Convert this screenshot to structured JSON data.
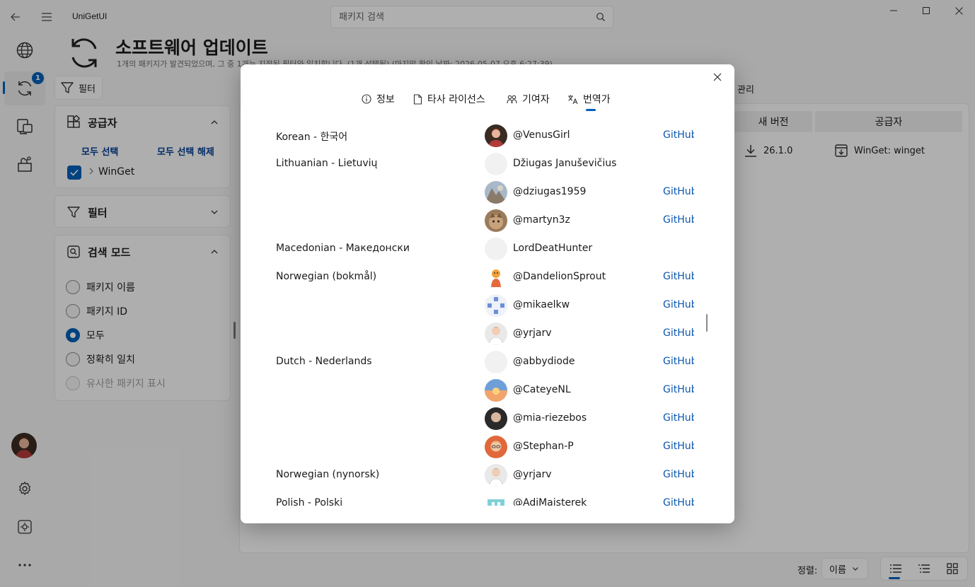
{
  "app": {
    "title": "UniGetUI"
  },
  "search": {
    "placeholder": "패키지 검색"
  },
  "nav": {
    "updates_badge": "1"
  },
  "page": {
    "title": "소프트웨어 업데이트",
    "subtitle": "1개의 패키지가 발견되었으며, 그 중 1개는 지정된 필터와 일치합니다. (1개 선택됨) (마지막 확인 날짜: 2026-05-07 오후 6:27:39)"
  },
  "toolbar": {
    "filter_label": "필터",
    "manage_label": "관리"
  },
  "sources_panel": {
    "title": "공급자",
    "select_all": "모두 선택",
    "deselect_all": "모두 선택 해제",
    "source_name": "WinGet"
  },
  "filters_panel": {
    "title": "필터"
  },
  "search_mode_panel": {
    "title": "검색 모드",
    "options": [
      "패키지 이름",
      "패키지 ID",
      "모두",
      "정확히 일치",
      "유사한 패키지 표시"
    ],
    "selected": "모두"
  },
  "table": {
    "headers": {
      "new_version": "새 버전",
      "source": "공급자"
    },
    "row": {
      "new_version": "26.1.0",
      "source": "WinGet: winget"
    }
  },
  "bottom_bar": {
    "sort_label": "정렬:",
    "sort_value": "이름"
  },
  "dialog": {
    "tabs": [
      "정보",
      "타사 라이선스",
      "기여자",
      "번역가"
    ],
    "active_tab": "번역가",
    "link_label": "GitHub",
    "rows": [
      {
        "language": "Korean - 한국어",
        "translator": "@VenusGirl",
        "link": true
      },
      {
        "language": "Lithuanian - Lietuvių",
        "translator": "Džiugas Januševičius",
        "link": false
      },
      {
        "language": "",
        "translator": "@dziugas1959",
        "link": true
      },
      {
        "language": "",
        "translator": "@martyn3z",
        "link": true
      },
      {
        "language": "Macedonian - Македонски",
        "translator": "LordDeatHunter",
        "link": false
      },
      {
        "language": "Norwegian (bokmål)",
        "translator": "@DandelionSprout",
        "link": true
      },
      {
        "language": "",
        "translator": "@mikaelkw",
        "link": true
      },
      {
        "language": "",
        "translator": "@yrjarv",
        "link": true
      },
      {
        "language": "Dutch - Nederlands",
        "translator": "@abbydiode",
        "link": true
      },
      {
        "language": "",
        "translator": "@CateyeNL",
        "link": true
      },
      {
        "language": "",
        "translator": "@mia-riezebos",
        "link": true
      },
      {
        "language": "",
        "translator": "@Stephan-P",
        "link": true
      },
      {
        "language": "Norwegian (nynorsk)",
        "translator": "@yrjarv",
        "link": true
      },
      {
        "language": "Polish - Polski",
        "translator": "@AdiMajsterek",
        "link": true
      }
    ]
  },
  "colors": {
    "accent": "#005fb8",
    "link": "#0b58b0"
  }
}
